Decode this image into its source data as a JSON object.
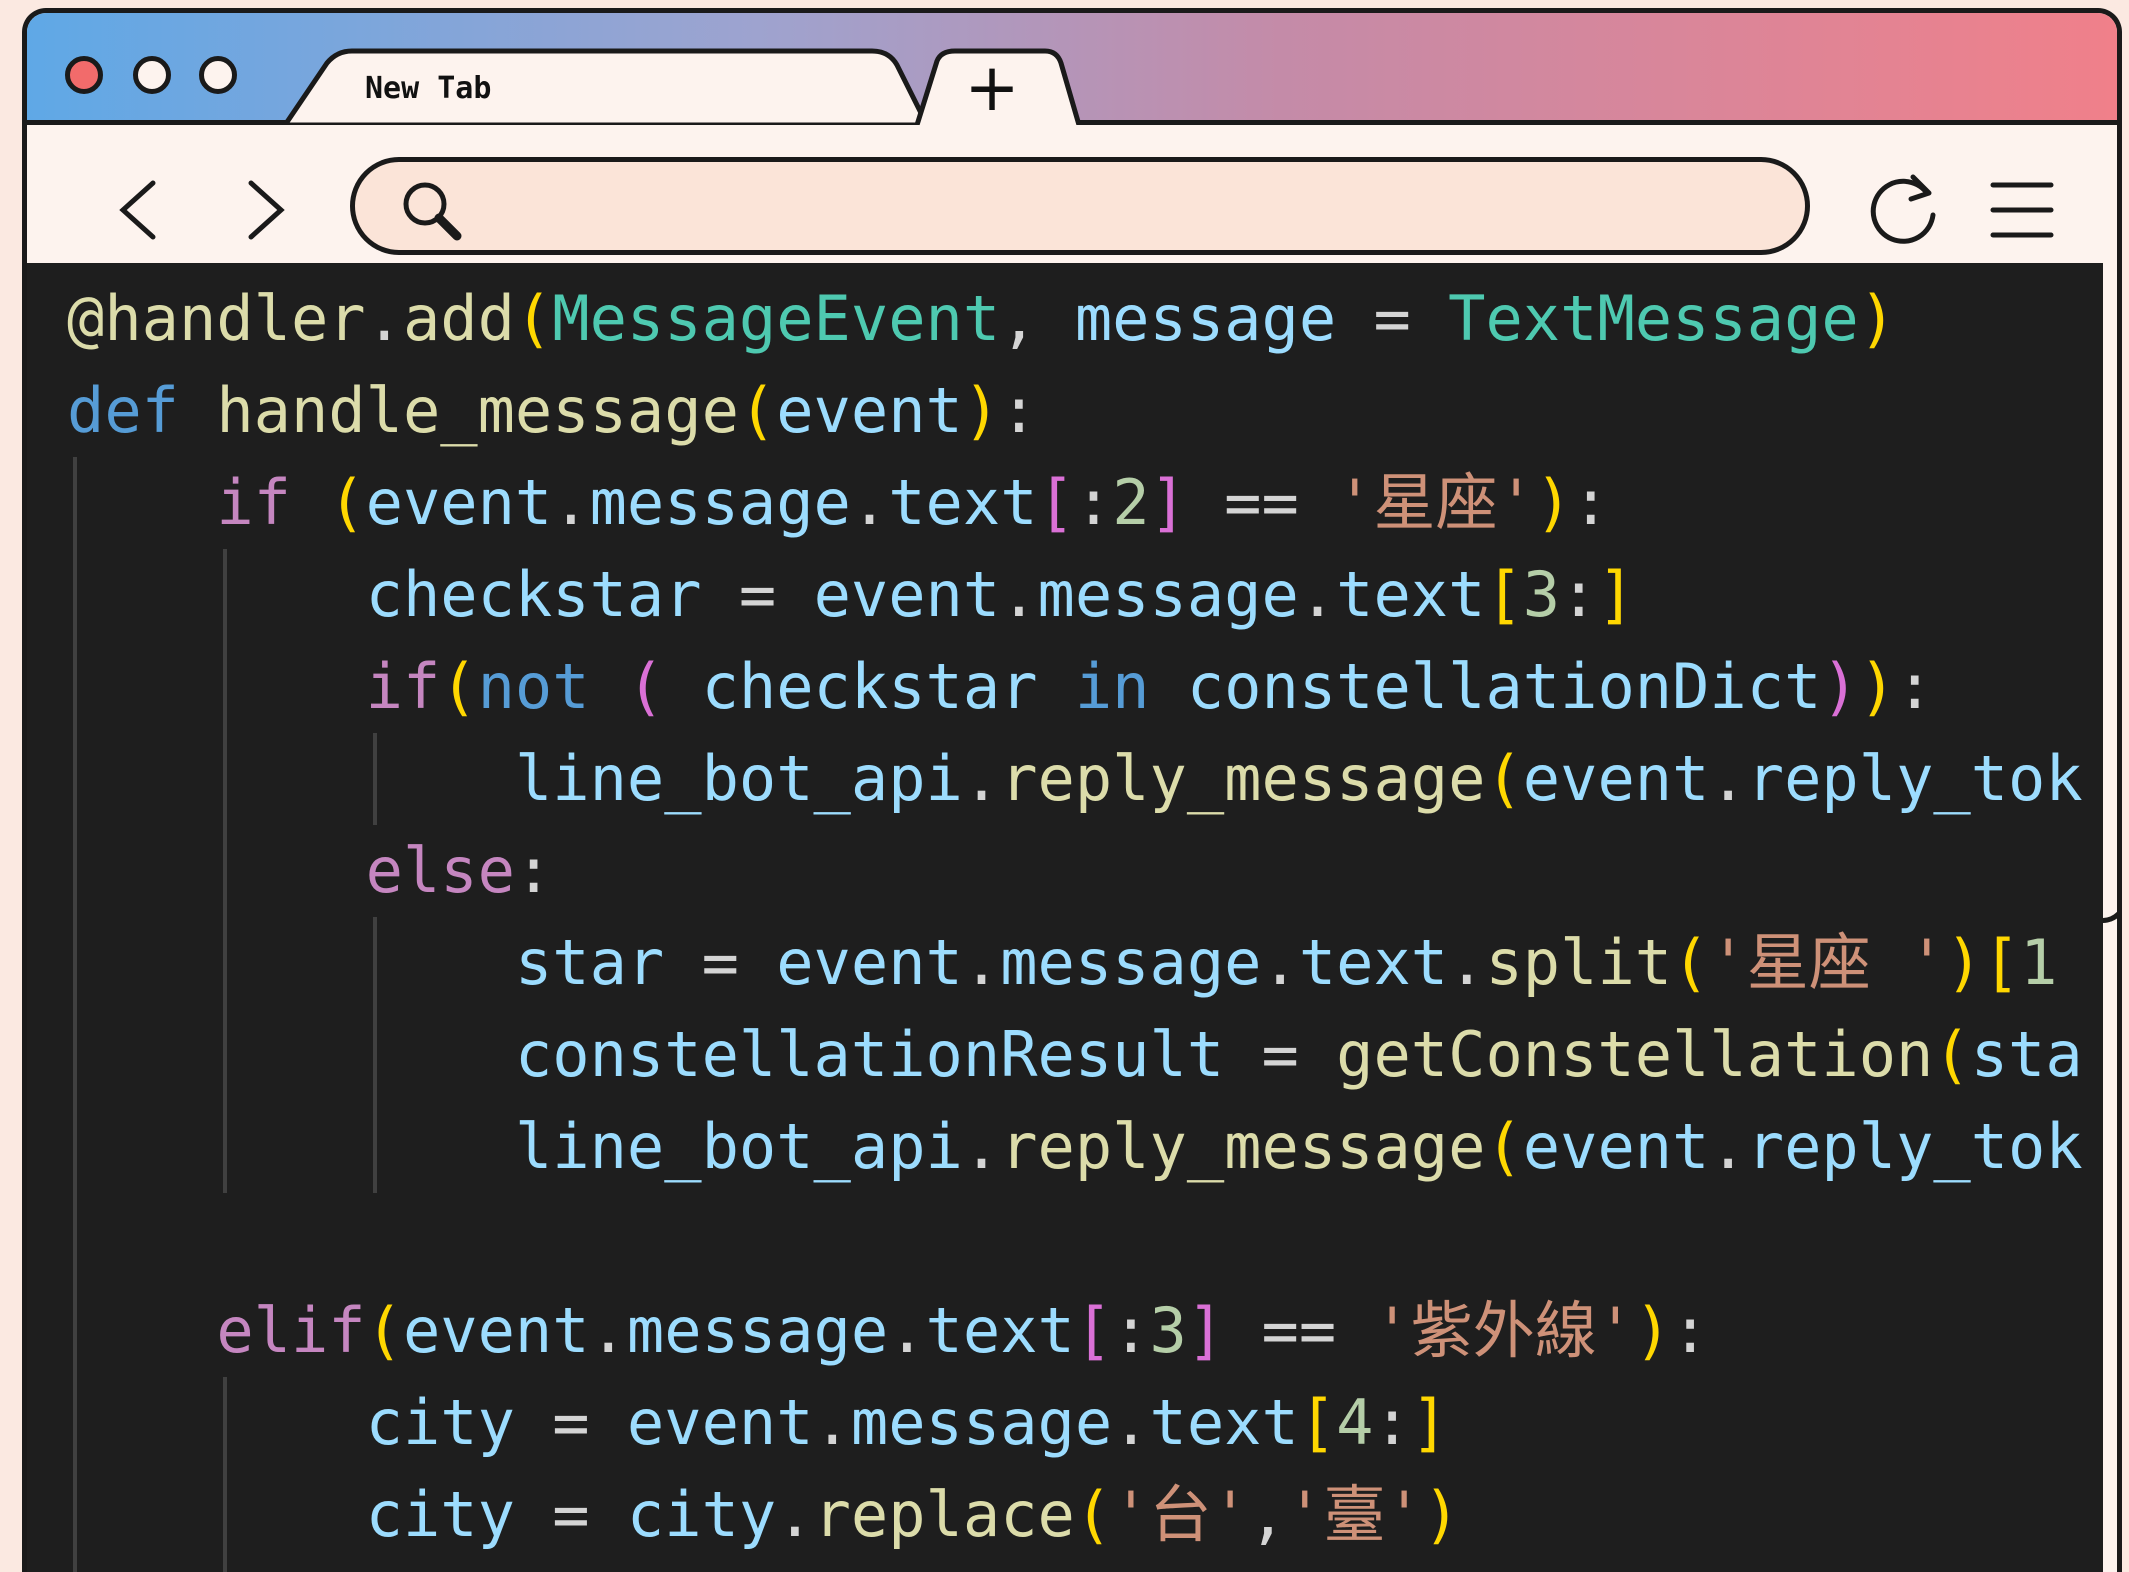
{
  "browser": {
    "tab_title": "New Tab",
    "new_tab_symbol": "+",
    "address_value": "",
    "address_placeholder": ""
  },
  "code": {
    "language": "python",
    "lines": [
      [
        [
          "dec",
          "@handler"
        ],
        [
          "o",
          "."
        ],
        [
          "f",
          "add"
        ],
        [
          "p1",
          "("
        ],
        [
          "t",
          "MessageEvent"
        ],
        [
          "o",
          ", "
        ],
        [
          "v",
          "message"
        ],
        [
          "o",
          " = "
        ],
        [
          "t",
          "TextMessage"
        ],
        [
          "p1",
          ")"
        ]
      ],
      [
        [
          "k",
          "def "
        ],
        [
          "f",
          "handle_message"
        ],
        [
          "p1",
          "("
        ],
        [
          "v",
          "event"
        ],
        [
          "p1",
          ")"
        ],
        [
          "o",
          ":"
        ]
      ],
      [
        [
          "o",
          "    "
        ],
        [
          "c",
          "if "
        ],
        [
          "p1",
          "("
        ],
        [
          "v",
          "event"
        ],
        [
          "o",
          "."
        ],
        [
          "v",
          "message"
        ],
        [
          "o",
          "."
        ],
        [
          "v",
          "text"
        ],
        [
          "p2",
          "["
        ],
        [
          "o",
          ":"
        ],
        [
          "n",
          "2"
        ],
        [
          "p2",
          "]"
        ],
        [
          "o",
          " == "
        ],
        [
          "s",
          "'星座'"
        ],
        [
          "p1",
          ")"
        ],
        [
          "o",
          ":"
        ]
      ],
      [
        [
          "o",
          "        "
        ],
        [
          "v",
          "checkstar"
        ],
        [
          "o",
          " = "
        ],
        [
          "v",
          "event"
        ],
        [
          "o",
          "."
        ],
        [
          "v",
          "message"
        ],
        [
          "o",
          "."
        ],
        [
          "v",
          "text"
        ],
        [
          "p1",
          "["
        ],
        [
          "n",
          "3"
        ],
        [
          "o",
          ":"
        ],
        [
          "p1",
          "]"
        ]
      ],
      [
        [
          "o",
          "        "
        ],
        [
          "c",
          "if"
        ],
        [
          "p1",
          "("
        ],
        [
          "k",
          "not "
        ],
        [
          "p2",
          "( "
        ],
        [
          "v",
          "checkstar "
        ],
        [
          "k",
          "in "
        ],
        [
          "v",
          "constellationDict"
        ],
        [
          "p2",
          ")"
        ],
        [
          "p1",
          ")"
        ],
        [
          "o",
          ":"
        ]
      ],
      [
        [
          "o",
          "            "
        ],
        [
          "v",
          "line_bot_api"
        ],
        [
          "o",
          "."
        ],
        [
          "f",
          "reply_message"
        ],
        [
          "p1",
          "("
        ],
        [
          "v",
          "event"
        ],
        [
          "o",
          "."
        ],
        [
          "v",
          "reply_tok"
        ]
      ],
      [
        [
          "o",
          "        "
        ],
        [
          "c",
          "else"
        ],
        [
          "o",
          ":"
        ]
      ],
      [
        [
          "o",
          "            "
        ],
        [
          "v",
          "star"
        ],
        [
          "o",
          " = "
        ],
        [
          "v",
          "event"
        ],
        [
          "o",
          "."
        ],
        [
          "v",
          "message"
        ],
        [
          "o",
          "."
        ],
        [
          "v",
          "text"
        ],
        [
          "o",
          "."
        ],
        [
          "f",
          "split"
        ],
        [
          "p1",
          "("
        ],
        [
          "s",
          "'星座 '"
        ],
        [
          "p1",
          ")"
        ],
        [
          "p1",
          "["
        ],
        [
          "n",
          "1"
        ]
      ],
      [
        [
          "o",
          "            "
        ],
        [
          "v",
          "constellationResult"
        ],
        [
          "o",
          " = "
        ],
        [
          "f",
          "getConstellation"
        ],
        [
          "p1",
          "("
        ],
        [
          "v",
          "sta"
        ]
      ],
      [
        [
          "o",
          "            "
        ],
        [
          "v",
          "line_bot_api"
        ],
        [
          "o",
          "."
        ],
        [
          "f",
          "reply_message"
        ],
        [
          "p1",
          "("
        ],
        [
          "v",
          "event"
        ],
        [
          "o",
          "."
        ],
        [
          "v",
          "reply_tok"
        ]
      ],
      [],
      [
        [
          "o",
          "    "
        ],
        [
          "c",
          "elif"
        ],
        [
          "p1",
          "("
        ],
        [
          "v",
          "event"
        ],
        [
          "o",
          "."
        ],
        [
          "v",
          "message"
        ],
        [
          "o",
          "."
        ],
        [
          "v",
          "text"
        ],
        [
          "p2",
          "["
        ],
        [
          "o",
          ":"
        ],
        [
          "n",
          "3"
        ],
        [
          "p2",
          "]"
        ],
        [
          "o",
          " == "
        ],
        [
          "s",
          "'紫外線'"
        ],
        [
          "p1",
          ")"
        ],
        [
          "o",
          ":"
        ]
      ],
      [
        [
          "o",
          "        "
        ],
        [
          "v",
          "city"
        ],
        [
          "o",
          " = "
        ],
        [
          "v",
          "event"
        ],
        [
          "o",
          "."
        ],
        [
          "v",
          "message"
        ],
        [
          "o",
          "."
        ],
        [
          "v",
          "text"
        ],
        [
          "p1",
          "["
        ],
        [
          "n",
          "4"
        ],
        [
          "o",
          ":"
        ],
        [
          "p1",
          "]"
        ]
      ],
      [
        [
          "o",
          "        "
        ],
        [
          "v",
          "city"
        ],
        [
          "o",
          " = "
        ],
        [
          "v",
          "city"
        ],
        [
          "o",
          "."
        ],
        [
          "f",
          "replace"
        ],
        [
          "p1",
          "("
        ],
        [
          "s",
          "'台'"
        ],
        [
          "o",
          ","
        ],
        [
          "s",
          "'臺'"
        ],
        [
          "p1",
          ")"
        ]
      ]
    ]
  }
}
